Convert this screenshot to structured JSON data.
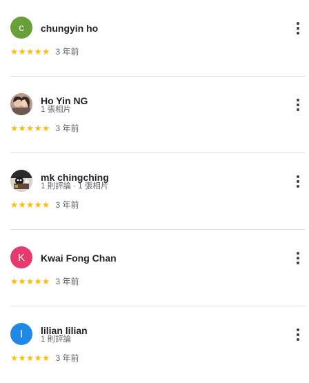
{
  "reviews": [
    {
      "name": "chungyin ho",
      "meta": "",
      "initial": "c",
      "avatar_color": "#689f38",
      "stars": "★★★★★",
      "time": "3 年前"
    },
    {
      "name": "Ho Yin NG",
      "meta": "1 張相片",
      "initial": "",
      "avatar_color": "",
      "stars": "★★★★★",
      "time": "3 年前"
    },
    {
      "name": "mk chingching",
      "meta": "1 則評論 · 1 張相片",
      "initial": "",
      "avatar_color": "",
      "stars": "★★★★★",
      "time": "3 年前"
    },
    {
      "name": "Kwai Fong Chan",
      "meta": "",
      "initial": "K",
      "avatar_color": "#e8396d",
      "stars": "★★★★★",
      "time": "3 年前"
    },
    {
      "name": "lilian lilian",
      "meta": "1 則評論",
      "initial": "l",
      "avatar_color": "#1e88e5",
      "stars": "★★★★★",
      "time": "3 年前"
    }
  ],
  "colors": {
    "star": "#fbbc04",
    "divider": "#e0e0e0",
    "secondary_text": "#5f6368"
  },
  "icons": {
    "more": "more-vertical-icon",
    "star": "star-icon"
  }
}
